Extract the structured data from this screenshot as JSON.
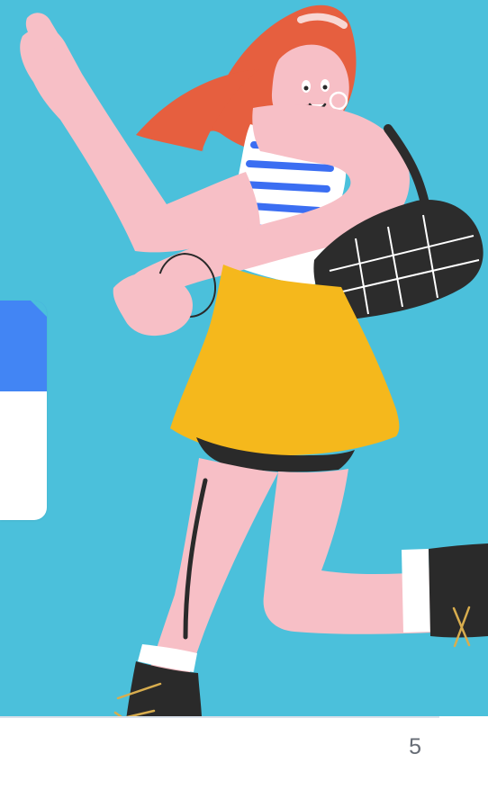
{
  "page": {
    "number": "5"
  },
  "colors": {
    "background": "#4bc0db",
    "card_header": "#4285f4",
    "card_body": "#ffffff",
    "skin": "#f7bfc6",
    "hair": "#e65f3f",
    "skirt": "#f5b81c",
    "bag": "#2c2c2c",
    "shirt_stripe": "#3b6ef2",
    "boot": "#2a2a2a"
  },
  "icons": {
    "illustration": "woman-walking-illustration"
  }
}
